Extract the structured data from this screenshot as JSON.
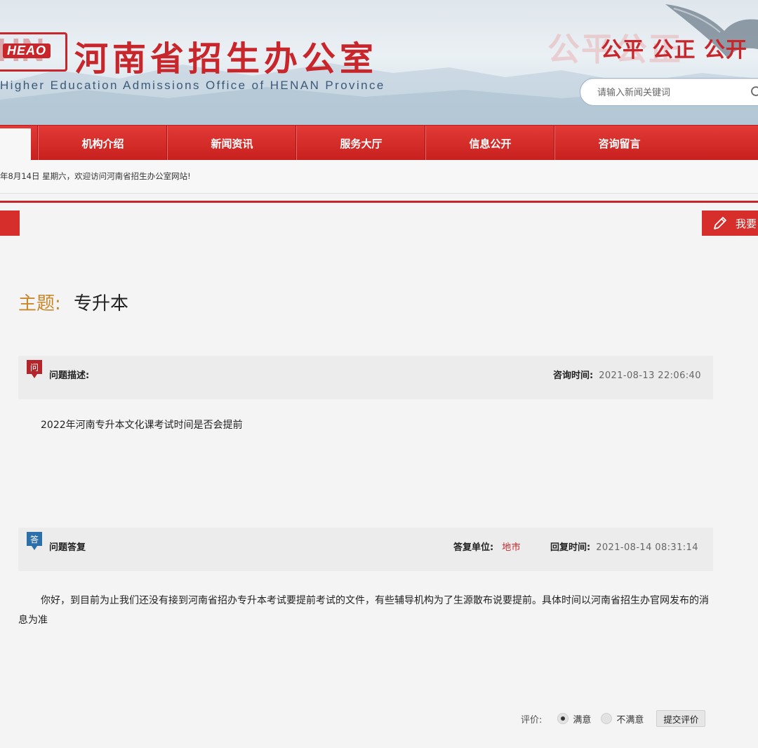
{
  "header": {
    "logo_letters": "HN",
    "logo_abbr": "HEAO",
    "title": "河南省招生办公室",
    "subtitle": "Higher Education Admissions Office of HENAN Province",
    "slogan": "公平 公正 公开",
    "search_placeholder": "请输入新闻关键词"
  },
  "nav": {
    "items": [
      {
        "label": "机构介绍"
      },
      {
        "label": "新闻资讯"
      },
      {
        "label": "服务大厅"
      },
      {
        "label": "信息公开"
      },
      {
        "label": "咨询留言"
      }
    ]
  },
  "infobar": {
    "text": "年8月14日  星期六，欢迎访问河南省招生办公室网站!"
  },
  "ask_button": {
    "label": "我要"
  },
  "topic": {
    "label": "主题:",
    "value": "专升本"
  },
  "question": {
    "badge": "问",
    "label": "问题描述:",
    "time_label": "咨询时间:",
    "time_value": "2021-08-13 22:06:40",
    "text": "2022年河南专升本文化课考试时间是否会提前"
  },
  "answer": {
    "badge": "答",
    "label": "问题答复",
    "unit_label": "答复单位:",
    "unit_value": "地市",
    "time_label": "回复时间:",
    "time_value": "2021-08-14 08:31:14",
    "text": "你好，到目前为止我们还没有接到河南省招办专升本考试要提前考试的文件，有些辅导机构为了生源散布说要提前。具体时间以河南省招生办官网发布的消息为准"
  },
  "rating": {
    "label": "评价:",
    "options": [
      {
        "label": "满意",
        "selected": true
      },
      {
        "label": "不满意",
        "selected": false
      }
    ],
    "submit_label": "提交评价"
  },
  "colors": {
    "brand_red": "#c8262b",
    "topic_label": "#c9882b",
    "answer_badge": "#2d6fa8"
  }
}
